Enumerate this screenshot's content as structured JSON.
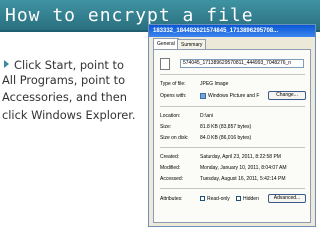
{
  "slide": {
    "title": "How to encrypt a file",
    "bullet_lines": [
      "Click Start, point to",
      "All Programs, point to",
      "Accessories, and then",
      "click Windows Explorer."
    ]
  },
  "dialog": {
    "title": "183332_184482621574845_1713896295708...",
    "tabs": [
      "General",
      "Summary"
    ],
    "file_name": "574045_171389629570811_444993_7048276_n",
    "type_of_file_label": "Type of file:",
    "type_of_file_value": "JPEG Image",
    "opens_with_label": "Opens with:",
    "opens_with_value": "Windows Picture and F",
    "change_button": "Change...",
    "location_label": "Location:",
    "location_value": "D:\\ani",
    "size_label": "Size:",
    "size_value": "81.8 KB (83,857 bytes)",
    "size_on_disk_label": "Size on disk:",
    "size_on_disk_value": "84.0 KB (86,016 bytes)",
    "created_label": "Created:",
    "created_value": "Saturday, April 23, 2011, 8:22:58 PM",
    "modified_label": "Modified:",
    "modified_value": "Monday, January 10, 2011, 8:04:07 AM",
    "accessed_label": "Accessed:",
    "accessed_value": "Tuesday, August 16, 2011, 5:42:14 PM",
    "attributes_label": "Attributes:",
    "readonly_label": "Read-only",
    "hidden_label": "Hidden",
    "advanced_button": "Advanced..."
  },
  "colors": {
    "title_bar": "#3f93a2",
    "title_text": "#ffffff",
    "bullet_arrow": "#3b8c9b",
    "dialog_title_bar": "#0a57d6"
  }
}
